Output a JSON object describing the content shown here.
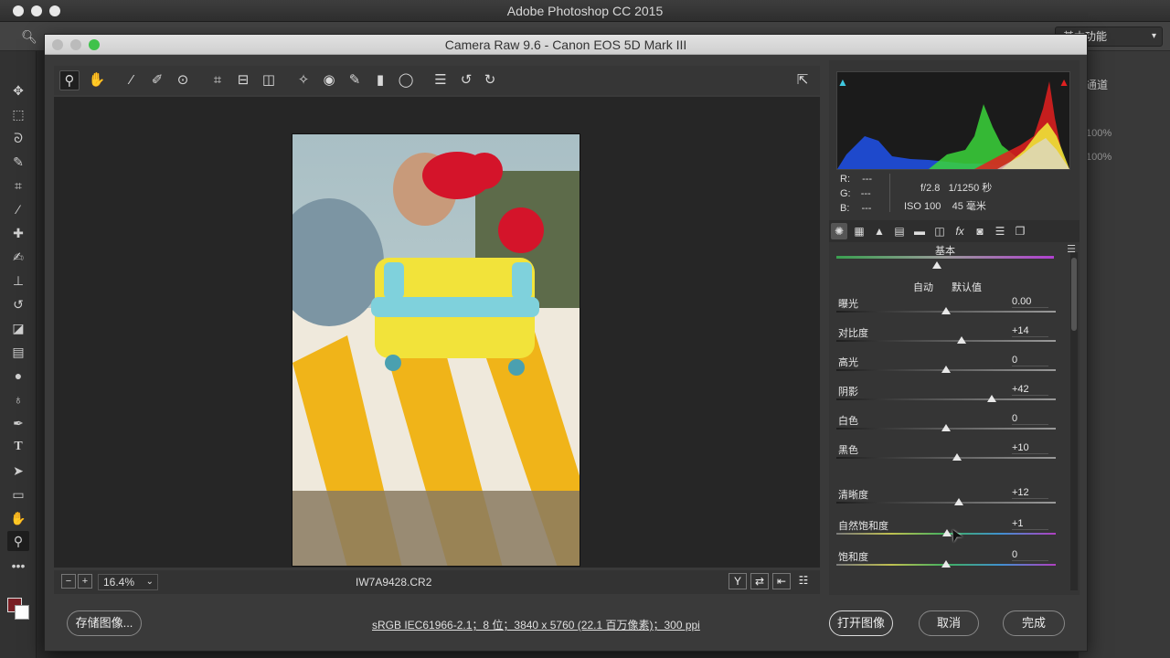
{
  "ps": {
    "app_title": "Adobe Photoshop CC 2015",
    "workspace": "基本功能",
    "right_panel_label": "通道",
    "right_percent_1": "100%",
    "right_percent_2": "100%"
  },
  "cr": {
    "window_title": "Camera Raw 9.6 -  Canon EOS 5D Mark III",
    "zoom": "16.4%",
    "filename": "IW7A9428.CR2",
    "save_button": "存储图像...",
    "info_link": "sRGB IEC61966-2.1；8 位；3840 x 5760 (22.1 百万像素)；300 ppi",
    "open_button": "打开图像",
    "cancel_button": "取消",
    "done_button": "完成"
  },
  "histogram": {
    "r_label": "R:",
    "g_label": "G:",
    "b_label": "B:",
    "r_value": "---",
    "g_value": "---",
    "b_value": "---",
    "aperture": "f/2.8",
    "shutter": "1/1250 秒",
    "iso": "ISO 100",
    "focal": "45 毫米"
  },
  "panel": {
    "section": "基本",
    "auto": "自动",
    "default": "默认值"
  },
  "sliders": [
    {
      "label": "曝光",
      "value": "0.00",
      "level": 0.5
    },
    {
      "label": "对比度",
      "value": "+14",
      "level": 0.57
    },
    {
      "label": "高光",
      "value": "0",
      "level": 0.5
    },
    {
      "label": "阴影",
      "value": "+42",
      "level": 0.71
    },
    {
      "label": "白色",
      "value": "0",
      "level": 0.5
    },
    {
      "label": "黑色",
      "value": "+10",
      "level": 0.55
    },
    {
      "label": "清晰度",
      "value": "+12",
      "level": 0.56
    },
    {
      "label": "自然饱和度",
      "value": "+1",
      "level": 0.505
    },
    {
      "label": "饱和度",
      "value": "0",
      "level": 0.5
    }
  ],
  "colors": {
    "active_tool_bg": "#1f1f1f",
    "shadow_clip": "#40c8e0",
    "highlight_clip": "#e02020",
    "foreground_swatch": "#7a1f24"
  }
}
